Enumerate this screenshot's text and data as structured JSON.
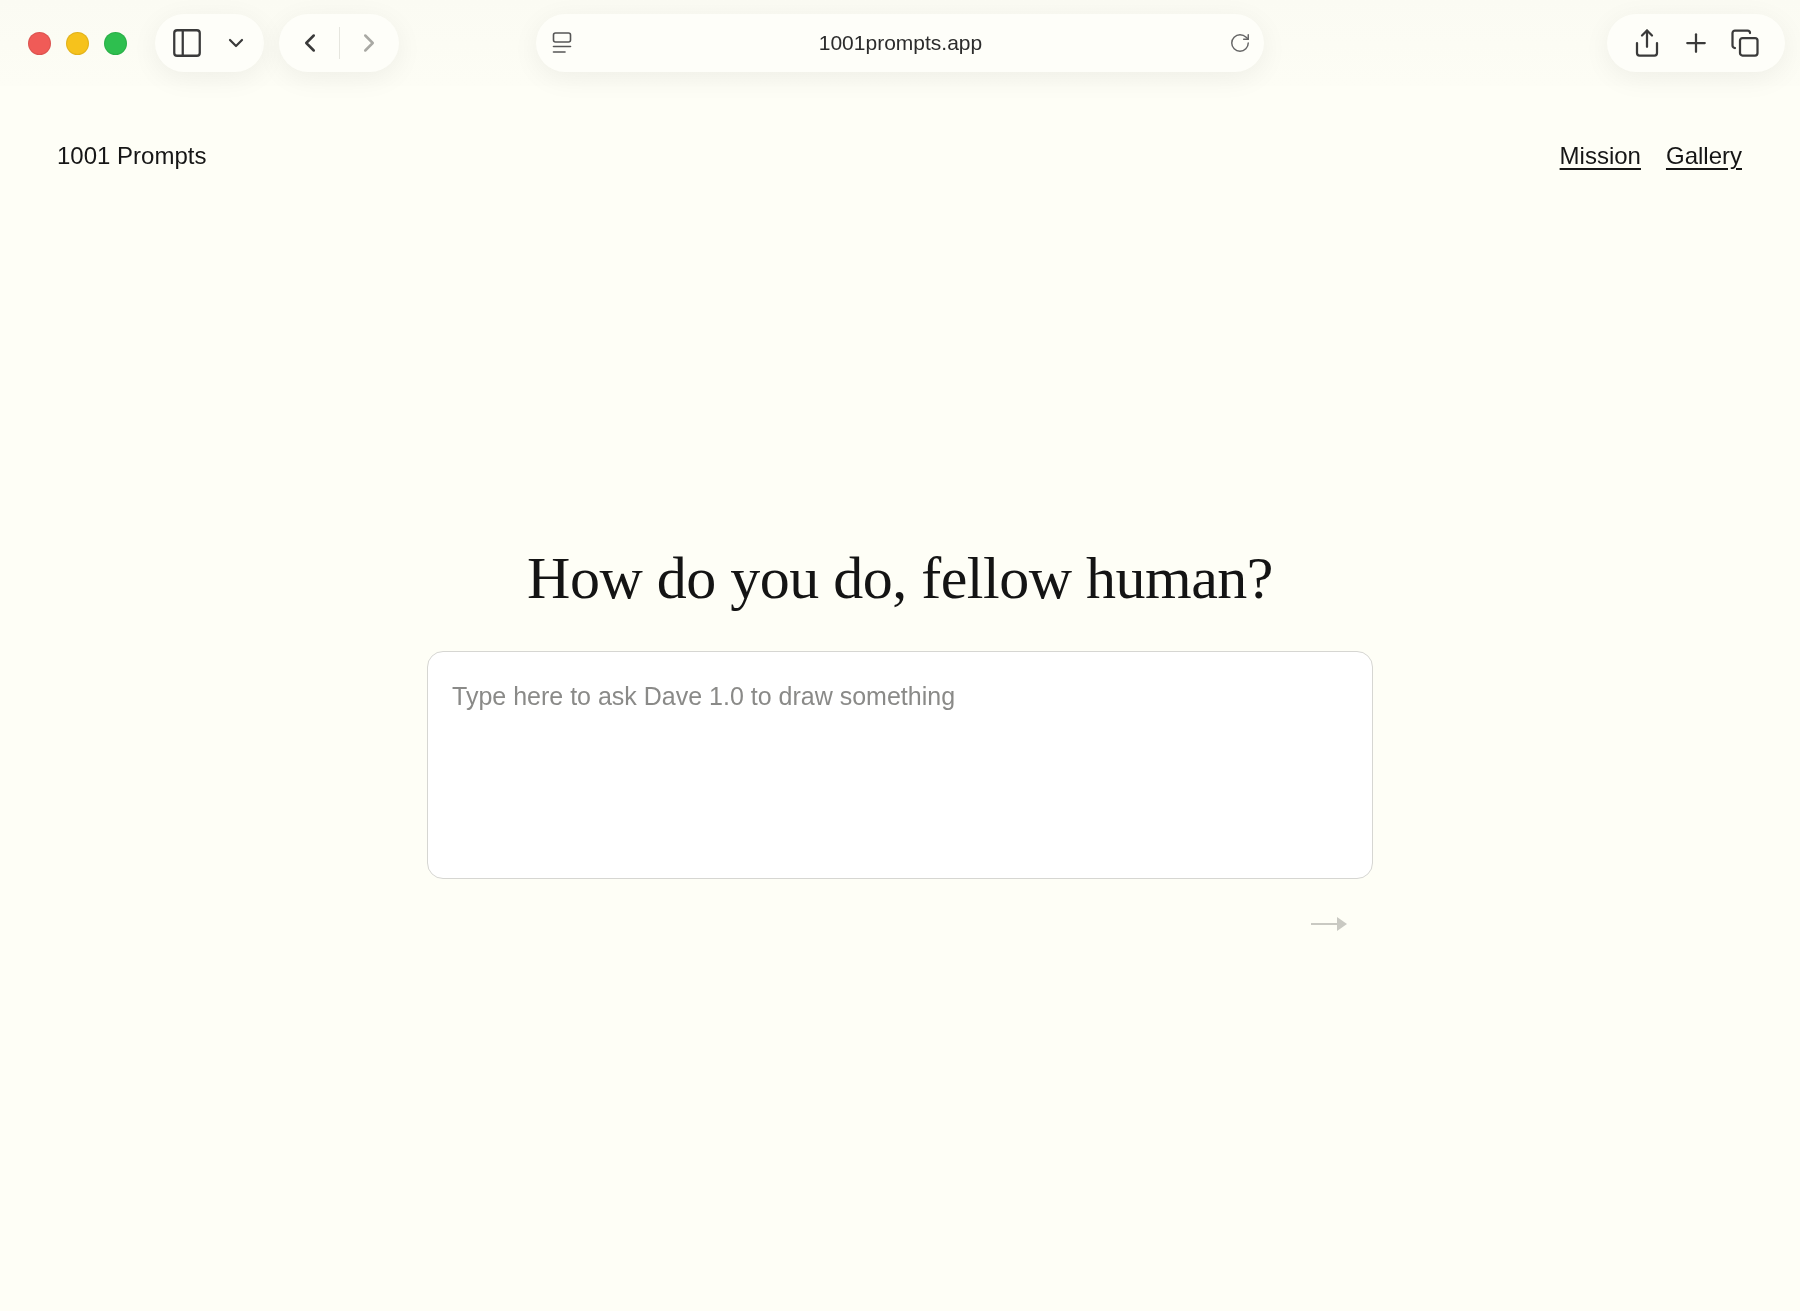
{
  "browser": {
    "back": {
      "disabled": false
    },
    "forward": {
      "disabled": true
    },
    "url": "1001prompts.app"
  },
  "header": {
    "logo": "1001 Prompts",
    "nav": [
      {
        "label": "Mission"
      },
      {
        "label": "Gallery"
      }
    ]
  },
  "main": {
    "heading": "How do you do, fellow human?",
    "prompt": {
      "placeholder": "Type here to ask Dave 1.0 to draw something"
    },
    "submit": {
      "disabled": true
    }
  }
}
